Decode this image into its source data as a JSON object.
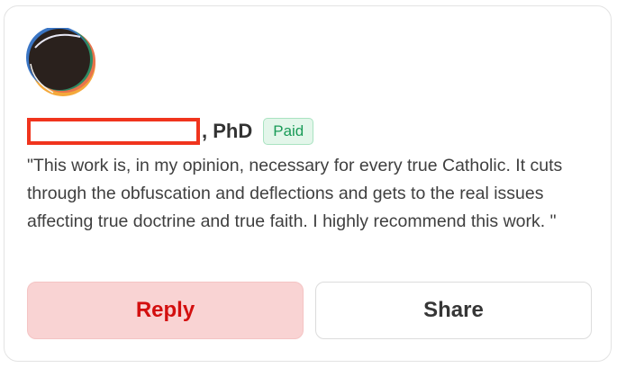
{
  "comment": {
    "author_suffix": ", PhD",
    "badge": "Paid",
    "text": "\"This work is, in my opinion, necessary for every true Catholic. It cuts through the obfuscation and deflections and gets to the real issues affecting true doctrine and true faith. I highly recommend this work. \""
  },
  "actions": {
    "reply_label": "Reply",
    "share_label": "Share"
  },
  "colors": {
    "reply_bg": "#f9d3d3",
    "reply_text": "#d30f0f",
    "badge_text": "#1a9b58",
    "badge_bg": "#e3f6ea",
    "redaction_border": "#f0341d"
  }
}
